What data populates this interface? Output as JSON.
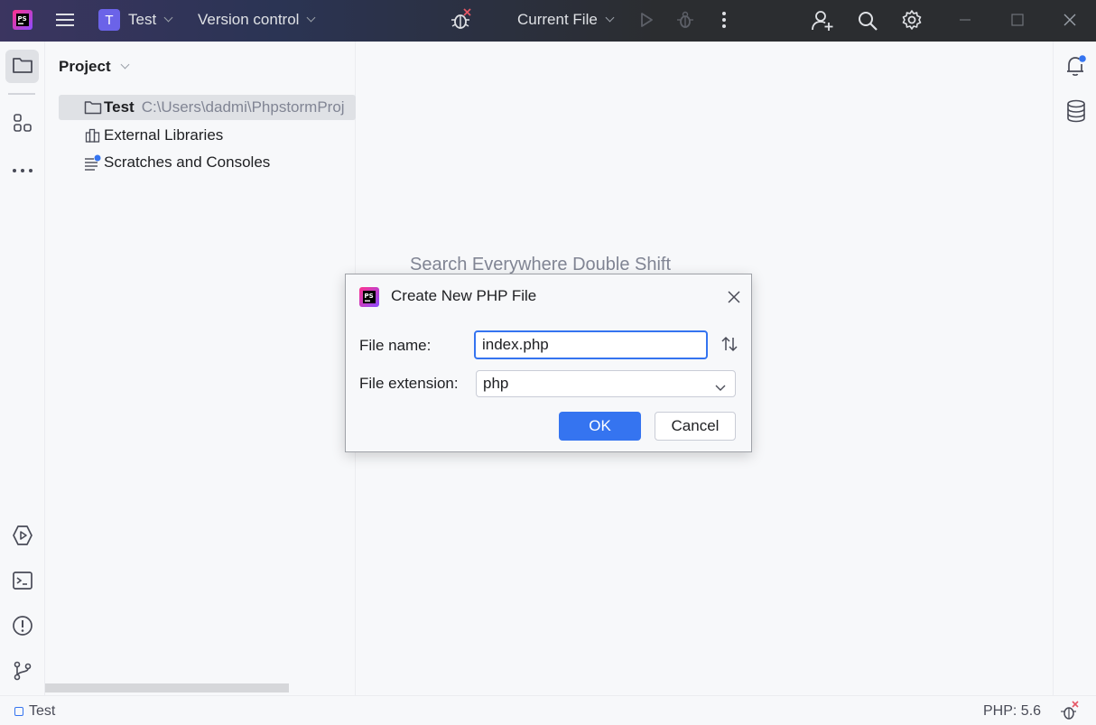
{
  "titlebar": {
    "project_badge": "T",
    "project_name": "Test",
    "vcs_label": "Version control",
    "run_config": "Current File",
    "icons": [
      "phpstorm-logo-icon",
      "main-menu-icon",
      "debug-disabled-icon",
      "run-icon",
      "debug-icon",
      "more-icon",
      "add-user-icon",
      "search-icon",
      "settings-icon",
      "minimize-icon",
      "maximize-icon",
      "close-icon"
    ]
  },
  "left_strip": {
    "icons": [
      "project-icon",
      "structure-icon",
      "more-tools-icon",
      "services-icon",
      "terminal-icon",
      "problems-icon",
      "git-icon"
    ]
  },
  "project_panel": {
    "title": "Project",
    "tree": [
      {
        "label": "Test",
        "path": "C:\\Users\\dadmi\\PhpstormProj",
        "icon": "folder-icon"
      },
      {
        "label": "External Libraries",
        "icon": "library-icon"
      },
      {
        "label": "Scratches and Consoles",
        "icon": "scratches-icon"
      }
    ]
  },
  "editor": {
    "hint": "Search Everywhere Double Shift"
  },
  "right_strip": {
    "icons": [
      "notifications-icon",
      "database-icon"
    ]
  },
  "statusbar": {
    "project": "Test",
    "php_version": "PHP: 5.6"
  },
  "dialog": {
    "title": "Create New PHP File",
    "file_name_label": "File name:",
    "file_name_value": "index.php",
    "file_extension_label": "File extension:",
    "file_extension_value": "php",
    "ok_label": "OK",
    "cancel_label": "Cancel"
  },
  "colors": {
    "accent": "#3574f0",
    "badge": "#6b63e8",
    "titlebar": "#2b2d30",
    "notification_dot": "#3574f0",
    "error_mark": "#e55765"
  }
}
